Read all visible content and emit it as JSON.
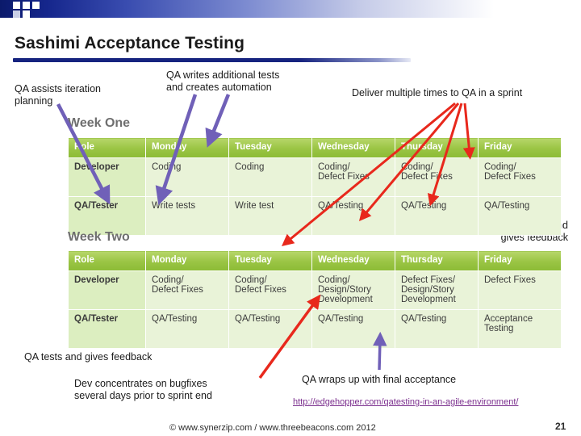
{
  "slide": {
    "title": "Sashimi Acceptance Testing",
    "page_number": "21",
    "footer": "© www.synerzip.com / www.threebeacons.com   2012",
    "link": "http://edgehopper.com/qatesting-in-an-agile-environment/"
  },
  "annotations": {
    "qa_assists": "QA assists iteration\nplanning",
    "qa_writes": "QA writes additional tests\nand creates automation",
    "deliver": "Deliver multiple times to QA in a sprint",
    "qa_tests_feedback_right": "QA tests and\ngives feedback",
    "qa_tests_feedback_left": "QA tests and gives feedback",
    "dev_concentrates": "Dev concentrates on bugfixes\nseveral days prior to sprint end",
    "qa_wraps": "QA wraps up with final acceptance"
  },
  "week_one": {
    "heading": "Week One",
    "columns": [
      "Role",
      "Monday",
      "Tuesday",
      "Wednesday",
      "Thursday",
      "Friday"
    ],
    "rows": [
      {
        "role": "Developer",
        "cells": [
          "Coding",
          "Coding",
          "Coding/\nDefect Fixes",
          "Coding/\nDefect Fixes",
          "Coding/\nDefect Fixes"
        ]
      },
      {
        "role": "QA/Tester",
        "cells": [
          "Write tests",
          "Write test",
          "QA/Testing",
          "QA/Testing",
          "QA/Testing"
        ]
      }
    ]
  },
  "week_two": {
    "heading": "Week Two",
    "columns": [
      "Role",
      "Monday",
      "Tuesday",
      "Wednesday",
      "Thursday",
      "Friday"
    ],
    "rows": [
      {
        "role": "Developer",
        "cells": [
          "Coding/\nDefect Fixes",
          "Coding/\nDefect Fixes",
          "Coding/\nDesign/Story\nDevelopment",
          "Defect Fixes/\nDesign/Story\nDevelopment",
          "Defect Fixes"
        ]
      },
      {
        "role": "QA/Tester",
        "cells": [
          "QA/Testing",
          "QA/Testing",
          "QA/Testing",
          "QA/Testing",
          "Acceptance\nTesting"
        ]
      }
    ]
  },
  "colors": {
    "header_green": "#99c443",
    "cell_green": "#e9f3d8",
    "rowhdr_green": "#dceec0",
    "arrow_purple": "#7060b8",
    "arrow_red": "#e8281c",
    "title_blue": "#16237f",
    "link_purple": "#7b2f8e"
  }
}
